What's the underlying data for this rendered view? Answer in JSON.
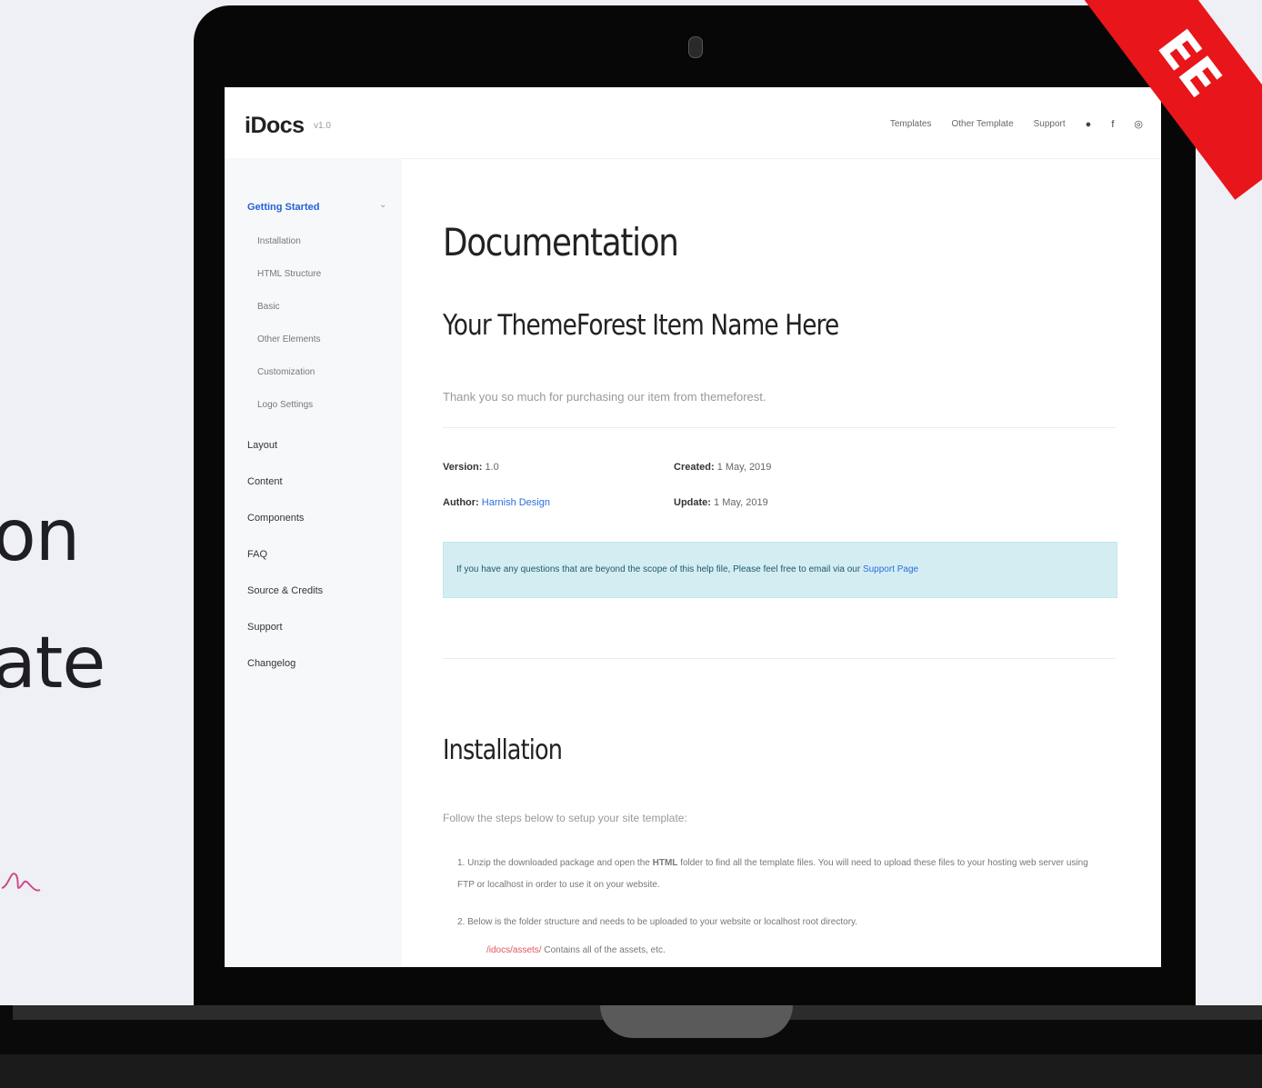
{
  "promo": {
    "line1": "on",
    "line2": "ate"
  },
  "ribbon": {
    "text": "EE",
    "color": "#e8151b"
  },
  "app": {
    "logo": "iDocs",
    "version": "v1.0",
    "topnav": [
      "Templates",
      "Other Template",
      "Support"
    ],
    "topnav_icons": [
      "twitter-icon",
      "facebook-icon",
      "dribbble-icon"
    ]
  },
  "sidebar": {
    "items": [
      {
        "label": "Getting Started",
        "active": true
      },
      {
        "label": "Layout"
      },
      {
        "label": "Content"
      },
      {
        "label": "Components"
      },
      {
        "label": "FAQ"
      },
      {
        "label": "Source & Credits"
      },
      {
        "label": "Support"
      },
      {
        "label": "Changelog"
      }
    ],
    "subitems": [
      "Installation",
      "HTML Structure",
      "Basic",
      "Other Elements",
      "Customization",
      "Logo Settings"
    ]
  },
  "main": {
    "title": "Documentation",
    "item_name": "Your ThemeForest Item Name Here",
    "lead": "Thank you so much for purchasing our item from themeforest.",
    "meta": {
      "version_label": "Version:",
      "version_value": "1.0",
      "author_label": "Author:",
      "author_value": "Harnish Design",
      "created_label": "Created:",
      "created_value": "1 May, 2019",
      "update_label": "Update:",
      "update_value": "1 May, 2019"
    },
    "alert": {
      "text": "If you have any questions that are beyond the scope of this help file, Please feel free to email via our",
      "link": "Support Page"
    },
    "installation": {
      "title": "Installation",
      "intro": "Follow the steps below to setup your site template:",
      "step1_a": "1. Unzip the downloaded package and open the",
      "step1_b": "HTML",
      "step1_c": "folder to find all the template files. You will need to upload these files to your hosting web server using FTP or localhost in order to use it on your website.",
      "step2": "2. Below is the folder structure and needs to be uploaded to your website or localhost root directory.",
      "step2_sub_code": "/idocs/assets/",
      "step2_sub_text": "Contains all of the assets, etc."
    }
  }
}
